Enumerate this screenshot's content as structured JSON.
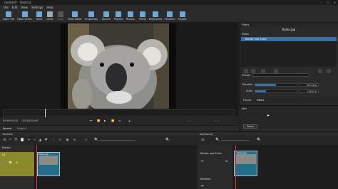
{
  "window": {
    "title": "Untitled* - Shotcut",
    "controls": [
      "–",
      "□",
      "✕"
    ]
  },
  "menu": [
    "File",
    "Edit",
    "View",
    "Settings",
    "Help"
  ],
  "toolbar": [
    {
      "label": "Open File",
      "icon": "folder-icon"
    },
    {
      "label": "Open Other...",
      "icon": "open-other-icon"
    },
    {
      "label": "Save",
      "icon": "save-icon"
    },
    {
      "label": "Undo",
      "icon": "undo-icon"
    },
    {
      "label": "Redo",
      "icon": "redo-icon"
    },
    {
      "label": "Peak Meter",
      "icon": "peak-meter-icon"
    },
    {
      "label": "Properties",
      "icon": "properties-icon"
    },
    {
      "label": "Recent",
      "icon": "recent-icon"
    },
    {
      "label": "Playlist",
      "icon": "playlist-icon"
    },
    {
      "label": "History",
      "icon": "history-icon"
    },
    {
      "label": "Filters",
      "icon": "filters-icon"
    },
    {
      "label": "Keyframes",
      "icon": "keyframes-icon"
    },
    {
      "label": "Timeline",
      "icon": "timeline-icon"
    },
    {
      "label": "Export",
      "icon": "export-icon"
    }
  ],
  "player": {
    "timecode_current": "00:00:00:10",
    "timecode_total": "/ 00:00:00:00",
    "scrub_fraction": 0.18,
    "tabs": [
      "Source",
      "Project"
    ]
  },
  "filters": {
    "panel_title": "Filters",
    "clip_name": "Koala.jpg",
    "section": "Video",
    "selected_filter": "Rotate and Scale",
    "preset_label": "Preset",
    "rotation_label": "Rotation",
    "rotation_value": "90.0 deg",
    "rotation_fraction": 0.5,
    "scale_label": "Scale",
    "scale_value": "100.0 %",
    "scale_fraction": 0.25,
    "tabs": [
      "Export",
      "Filters"
    ],
    "jobs_label": "Jobs",
    "pause_label": "Pause"
  },
  "timeline": {
    "title": "Timeline",
    "master_label": "Master",
    "track_label": "V1",
    "clip_label": "Koala.jpg"
  },
  "keyframes": {
    "title": "Keyframes",
    "rows": [
      "Rotate and Scale",
      "Rotation"
    ],
    "clip_label": "Koala.jpg"
  }
}
